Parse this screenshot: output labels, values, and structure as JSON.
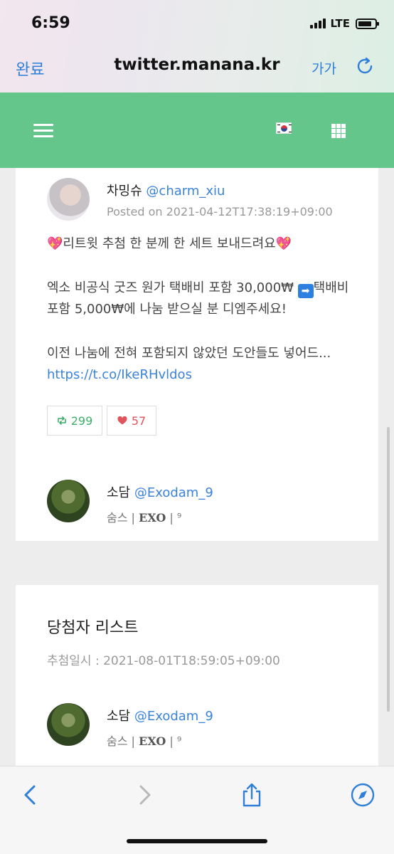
{
  "status_bar": {
    "time": "6:59",
    "network": "LTE"
  },
  "browser": {
    "done_label": "완료",
    "url": "twitter.manana.kr",
    "text_size_label": "가가"
  },
  "tweet": {
    "author_name": "차밍슈",
    "author_handle": "@charm_xiu",
    "posted": "Posted on 2021-04-12T17:38:19+09:00",
    "line1_emoji": "💖",
    "line1_text": "리트윗 추첨 한 분께 한 세트 보내드려요",
    "line2_text_a": "엑소 비공식 굿즈 원가 택배비 포함 30,000₩ ",
    "line2_arrow": "➡",
    "line2_text_b": "택배비 포함 5,000₩에 나눔 받으실 분 디엠주세요!",
    "line3_text": "이전 나눔에 전혀 포함되지 않았던 도안들도 넣어드...",
    "link": "https://t.co/IkeRHvldos",
    "retweets": "299",
    "likes": "57"
  },
  "participant": {
    "name": "소담",
    "handle": "@Exodam_9",
    "bio_prefix": "숨스 |",
    "bio_group": "EXO",
    "bio_suffix": "| ⁹"
  },
  "winner_section": {
    "title": "당첨자 리스트",
    "draw_date": "추첨일시 : 2021-08-01T18:59:05+09:00"
  },
  "winner": {
    "name": "소담",
    "handle": "@Exodam_9",
    "bio_prefix": "숨스 |",
    "bio_group": "EXO",
    "bio_suffix": "| ⁹"
  },
  "colors": {
    "accent": "#65c68c",
    "link": "#3b83d8",
    "retweet": "#3dae6a",
    "like": "#e0545c"
  }
}
